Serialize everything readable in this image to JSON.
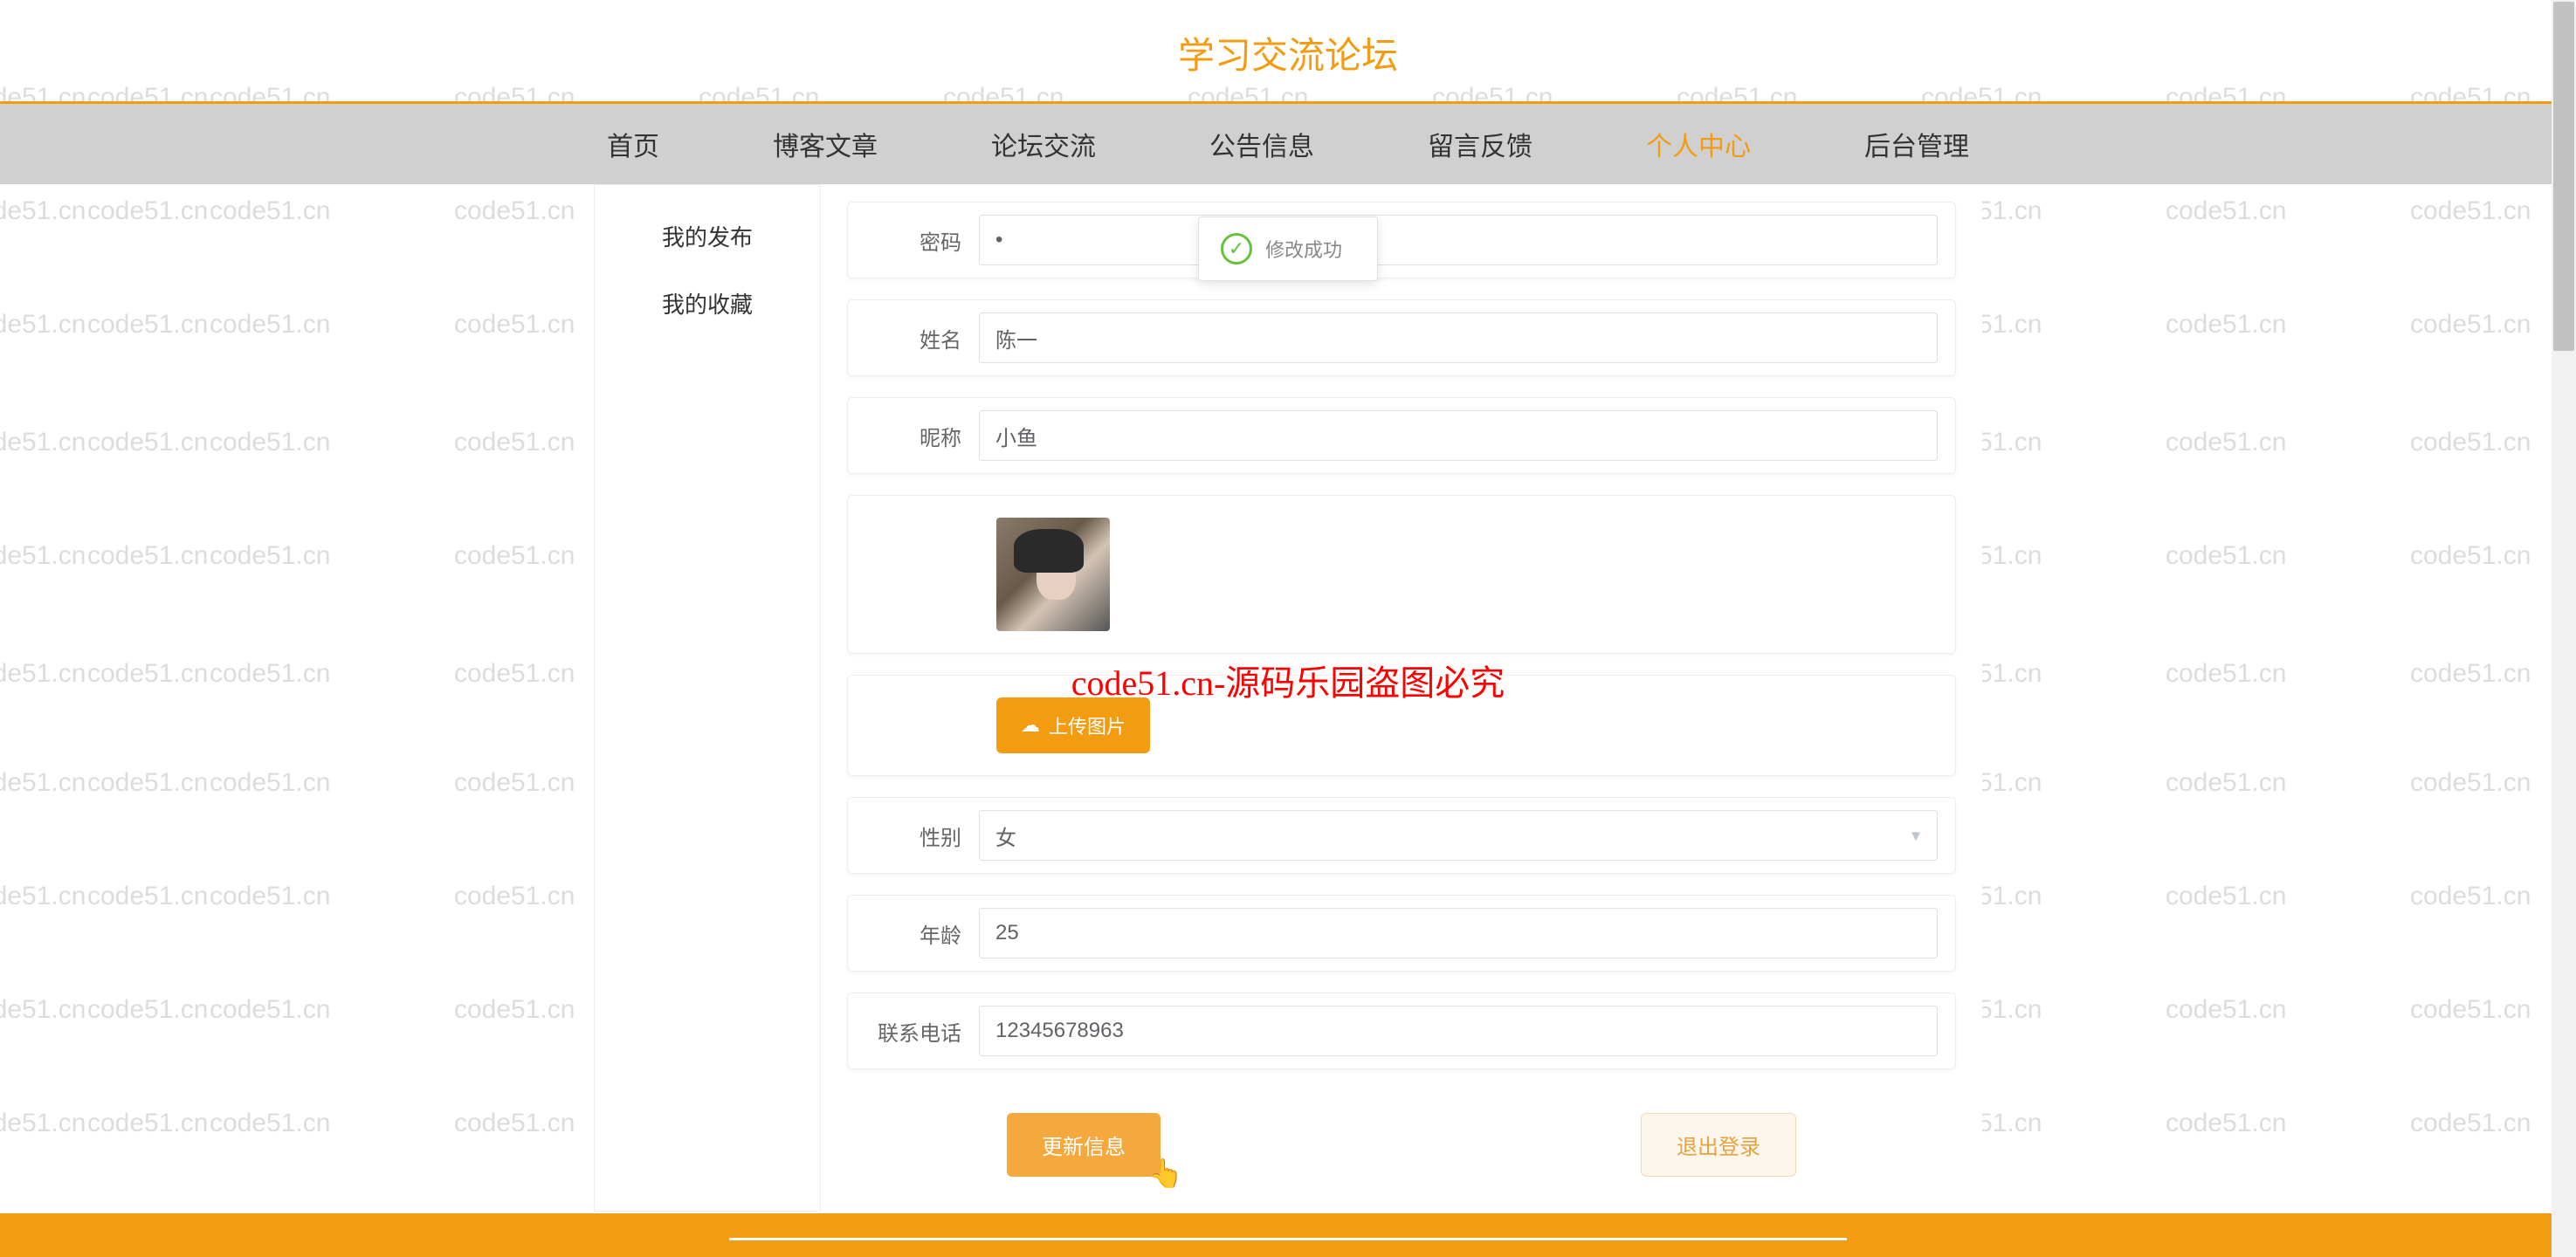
{
  "site": {
    "title": "学习交流论坛"
  },
  "nav": {
    "items": [
      {
        "label": "首页"
      },
      {
        "label": "博客文章"
      },
      {
        "label": "论坛交流"
      },
      {
        "label": "公告信息"
      },
      {
        "label": "留言反馈"
      },
      {
        "label": "个人中心"
      },
      {
        "label": "后台管理"
      }
    ]
  },
  "sidebar": {
    "items": [
      {
        "label": "我的发布"
      },
      {
        "label": "我的收藏"
      }
    ]
  },
  "toast": {
    "text": "修改成功"
  },
  "form": {
    "password": {
      "label": "密码",
      "value": "•"
    },
    "name": {
      "label": "姓名",
      "value": "陈一"
    },
    "nickname": {
      "label": "昵称",
      "value": "小鱼"
    },
    "upload_label": "上传图片",
    "gender": {
      "label": "性别",
      "value": "女"
    },
    "age": {
      "label": "年龄",
      "value": "25"
    },
    "phone": {
      "label": "联系电话",
      "value": "12345678963"
    }
  },
  "buttons": {
    "update": "更新信息",
    "logout": "退出登录"
  },
  "watermark_text": "code51.cn",
  "copyright_text": "code51.cn-源码乐园盗图必究"
}
